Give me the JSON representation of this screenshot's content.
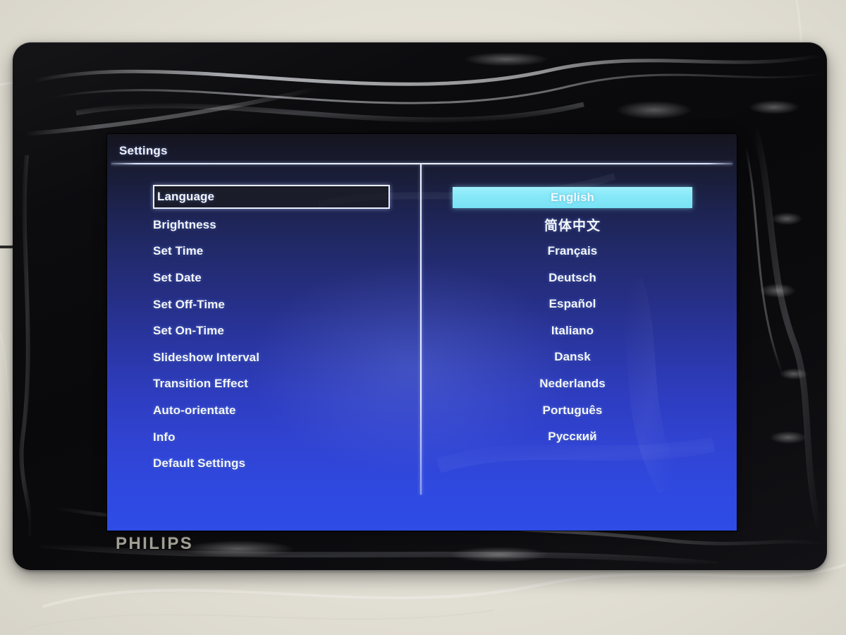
{
  "device": {
    "brand": "PHILIPS",
    "type": "digital-photo-frame"
  },
  "screen": {
    "title": "Settings",
    "colors": {
      "screen_top": "#15151f",
      "screen_bottom": "#2e4ce6",
      "highlight_bar": "#86e8f8",
      "focus_border": "#e9eefc",
      "text": "#f4f6fb",
      "brand_text": "#a9a79c",
      "bezel": "#0b0b0e",
      "backdrop": "#e6e3d9"
    },
    "settings_menu": [
      {
        "label": "Language",
        "focused": true
      },
      {
        "label": "Brightness",
        "focused": false
      },
      {
        "label": "Set Time",
        "focused": false
      },
      {
        "label": "Set Date",
        "focused": false
      },
      {
        "label": "Set Off-Time",
        "focused": false
      },
      {
        "label": "Set On-Time",
        "focused": false
      },
      {
        "label": "Slideshow Interval",
        "focused": false
      },
      {
        "label": "Transition Effect",
        "focused": false
      },
      {
        "label": "Auto-orientate",
        "focused": false
      },
      {
        "label": "Info",
        "focused": false
      },
      {
        "label": "Default Settings",
        "focused": false
      }
    ],
    "language_options": [
      {
        "label": "English",
        "selected": true,
        "cjk": false
      },
      {
        "label": "简体中文",
        "selected": false,
        "cjk": true
      },
      {
        "label": "Français",
        "selected": false,
        "cjk": false
      },
      {
        "label": "Deutsch",
        "selected": false,
        "cjk": false
      },
      {
        "label": "Español",
        "selected": false,
        "cjk": false
      },
      {
        "label": "Italiano",
        "selected": false,
        "cjk": false
      },
      {
        "label": "Dansk",
        "selected": false,
        "cjk": false
      },
      {
        "label": "Nederlands",
        "selected": false,
        "cjk": false
      },
      {
        "label": "Português",
        "selected": false,
        "cjk": false
      },
      {
        "label": "Русский",
        "selected": false,
        "cjk": false
      }
    ]
  }
}
